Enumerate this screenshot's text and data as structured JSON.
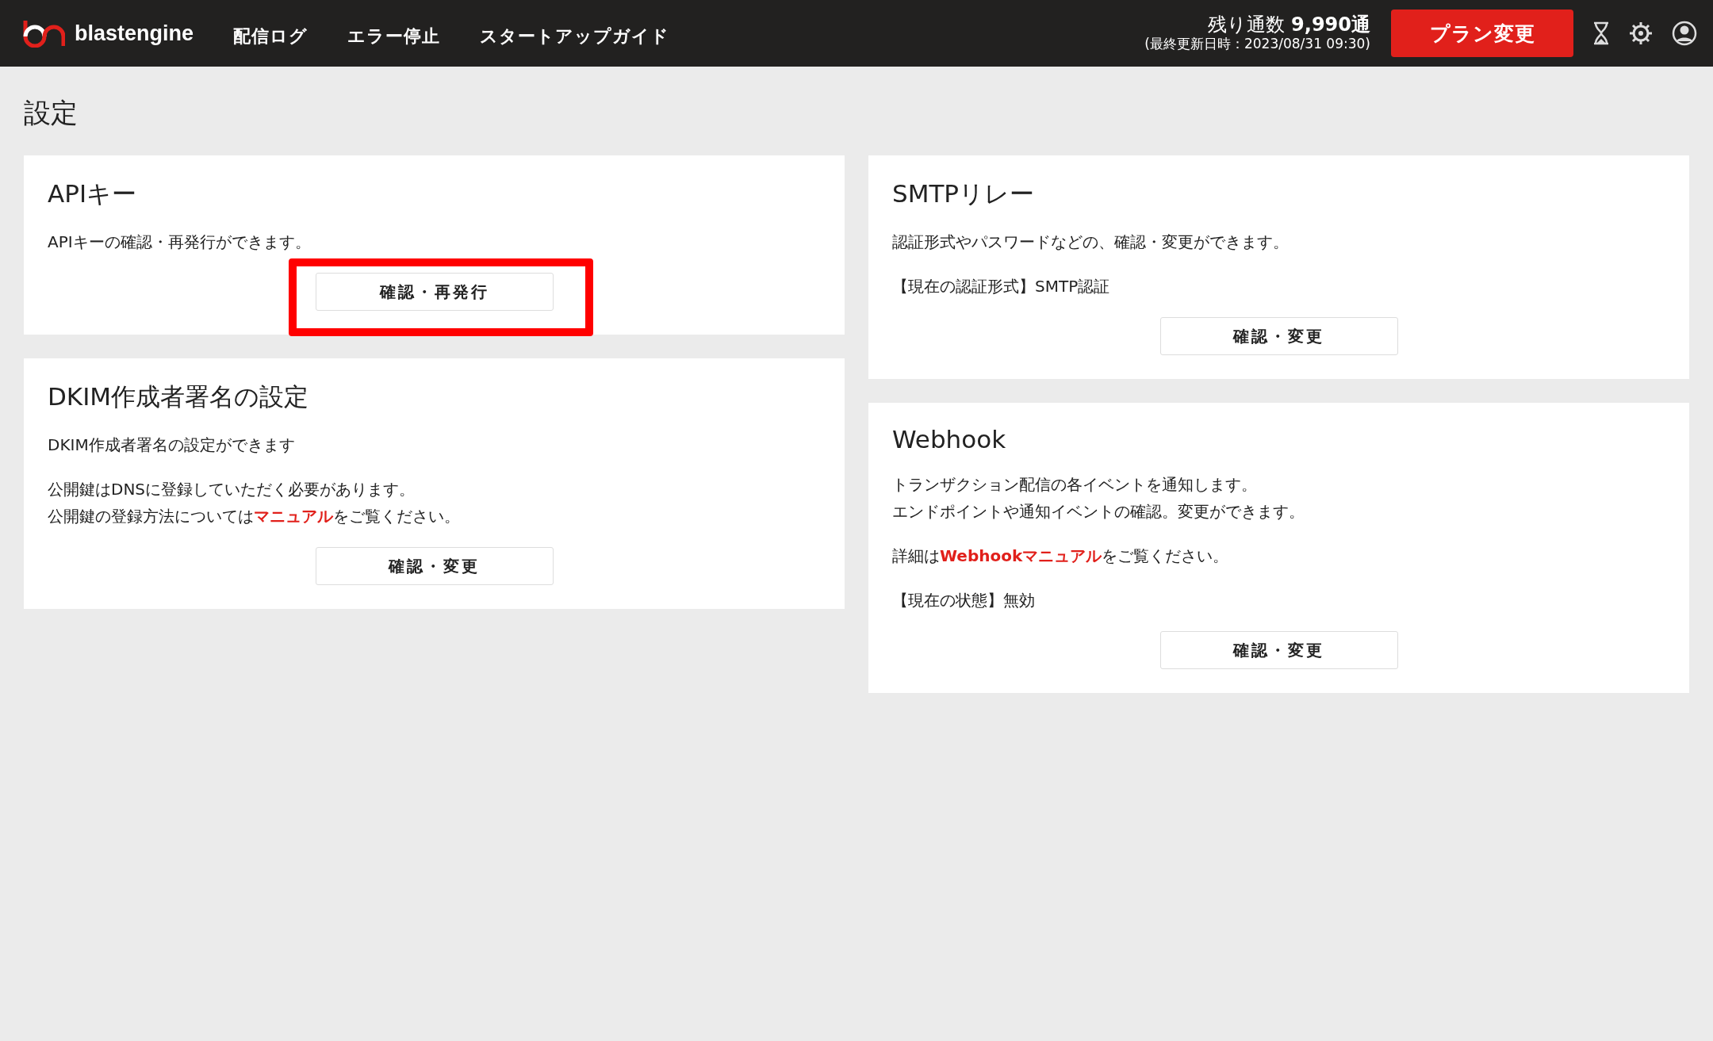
{
  "header": {
    "logo_text": "blastengine",
    "nav": [
      {
        "label": "配信ログ"
      },
      {
        "label": "エラー停止"
      },
      {
        "label": "スタートアップガイド"
      }
    ],
    "remaining": "残り通数 **9,990通**",
    "updated": "(最終更新日時：2023/08/31 09:30)",
    "plan_button": "プラン変更"
  },
  "page_title": "設定",
  "columns": [
    {
      "cards": [
        {
          "title": "APIキー",
          "paragraphs": [
            [
              {
                "text": "APIキーの確認・再発行ができます。"
              }
            ]
          ],
          "button": {
            "label": "確認・再発行",
            "highlighted": true
          }
        },
        {
          "title": "DKIM作成者署名の設定",
          "paragraphs": [
            [
              {
                "text": "DKIM作成者署名の設定ができます"
              }
            ],
            [
              {
                "text": "公開鍵はDNSに登録していただく必要があります。"
              },
              {
                "text": "公開鍵の登録方法については",
                "link": "マニュアル",
                "after": "をご覧ください。"
              }
            ]
          ],
          "button": {
            "label": "確認・変更",
            "highlighted": false
          }
        }
      ]
    },
    {
      "cards": [
        {
          "title": "SMTPリレー",
          "paragraphs": [
            [
              {
                "text": "認証形式やパスワードなどの、確認・変更ができます。"
              }
            ],
            [
              {
                "text": "【現在の認証形式】SMTP認証"
              }
            ]
          ],
          "button": {
            "label": "確認・変更",
            "highlighted": false
          }
        },
        {
          "title": "Webhook",
          "paragraphs": [
            [
              {
                "text": "トランザクション配信の各イベントを通知します。"
              },
              {
                "text": "エンドポイントや通知イベントの確認。変更ができます。"
              }
            ],
            [
              {
                "text": "詳細は",
                "link": "Webhookマニュアル",
                "after": "をご覧ください。"
              }
            ],
            [
              {
                "text": "【現在の状態】無効"
              }
            ]
          ],
          "button": {
            "label": "確認・変更",
            "highlighted": false
          }
        }
      ]
    }
  ]
}
